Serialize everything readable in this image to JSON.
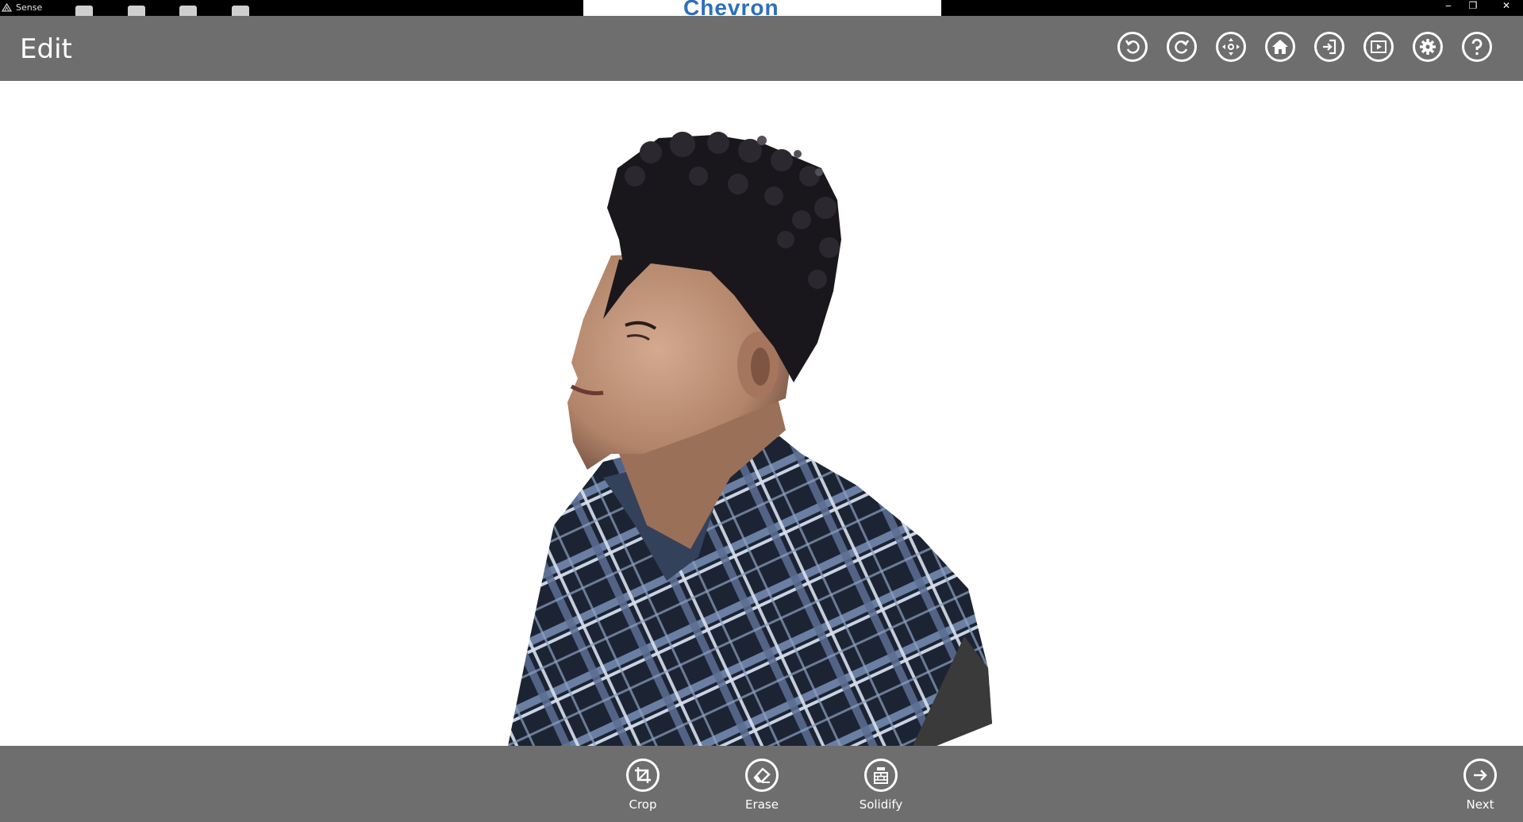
{
  "window": {
    "app_title": "Sense",
    "background_tab_text": "Chevron",
    "controls": {
      "minimize": "‒",
      "restore": "❐",
      "close": "✕"
    }
  },
  "header": {
    "title": "Edit",
    "toolbar": [
      {
        "name": "undo-icon"
      },
      {
        "name": "redo-icon"
      },
      {
        "name": "move-icon"
      },
      {
        "name": "home-icon"
      },
      {
        "name": "export-icon"
      },
      {
        "name": "play-icon"
      },
      {
        "name": "settings-icon"
      },
      {
        "name": "help-icon"
      }
    ]
  },
  "tools": {
    "crop_label": "Crop",
    "erase_label": "Erase",
    "solidify_label": "Solidify",
    "next_label": "Next"
  },
  "colors": {
    "bar": "#6e6e6e",
    "canvas": "#ffffff",
    "icon": "#ffffff"
  }
}
